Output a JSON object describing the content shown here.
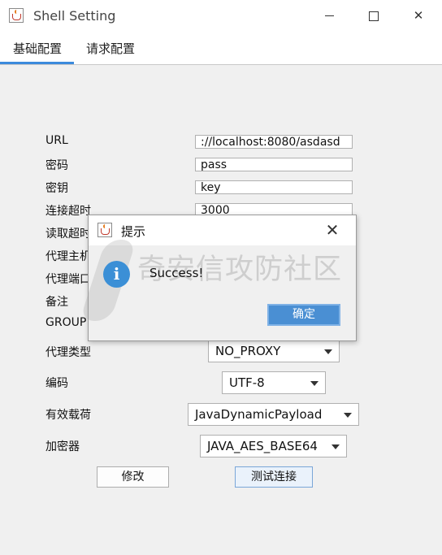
{
  "window": {
    "title": "Shell Setting"
  },
  "tabs": [
    {
      "label": "基础配置"
    },
    {
      "label": "请求配置"
    }
  ],
  "form": {
    "labels": [
      "URL",
      "密码",
      "密钥",
      "连接超时",
      "读取超时",
      "代理主机",
      "代理端口",
      "备注",
      "GROUP"
    ],
    "url_value": "://localhost:8080/asdasd",
    "password_value": "pass",
    "key_value": "key",
    "connect_timeout_value": "3000",
    "proxy_type_label": "代理类型",
    "proxy_type_value": "NO_PROXY",
    "encoding_label": "编码",
    "encoding_value": "UTF-8",
    "payload_label": "有效载荷",
    "payload_value": "JavaDynamicPayload",
    "cryption_label": "加密器",
    "cryption_value": "JAVA_AES_BASE64",
    "modify_button": "修改",
    "test_button": "测试连接"
  },
  "dialog": {
    "title": "提示",
    "message": "Success!",
    "ok_button": "确定",
    "watermark": "奇安信攻防社区"
  }
}
